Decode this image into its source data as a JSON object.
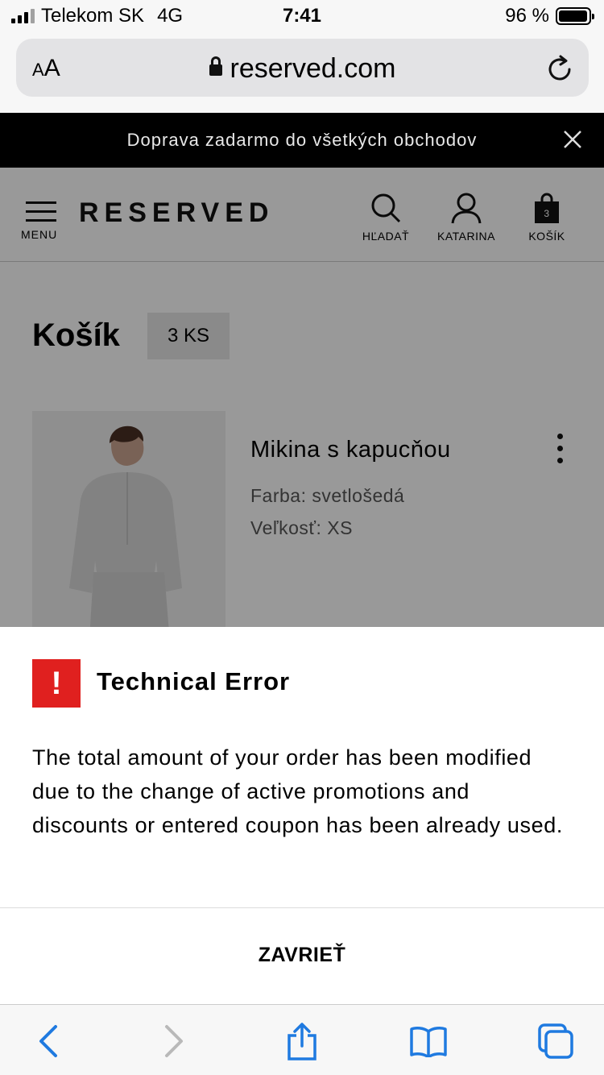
{
  "status_bar": {
    "carrier": "Telekom SK",
    "network": "4G",
    "time": "7:41",
    "battery": "96 %",
    "battery_level": 0.96
  },
  "browser": {
    "aa_label_small": "A",
    "aa_label_large": "A",
    "url": "reserved.com"
  },
  "promo": {
    "text": "Doprava zadarmo do všetkých obchodov"
  },
  "header": {
    "menu_label": "MENU",
    "logo": "RESERVED",
    "search_label": "HĽADAŤ",
    "account_label": "KATARINA",
    "cart_label": "KOŠÍK",
    "cart_badge": "3"
  },
  "cart": {
    "title": "Košík",
    "count": "3 KS",
    "item": {
      "name": "Mikina s kapucňou",
      "color": "Farba: svetlošedá",
      "size": "Veľkosť: XS"
    }
  },
  "modal": {
    "badge": "!",
    "title": "Technical Error",
    "message": "The total amount of your order has been modified due to the change of active promotions and discounts or entered coupon has been already used.",
    "close_label": "ZAVRIEŤ"
  },
  "colors": {
    "error_red": "#e0201f",
    "ios_blue": "#1f7ae0",
    "banner_bg": "#000000"
  }
}
